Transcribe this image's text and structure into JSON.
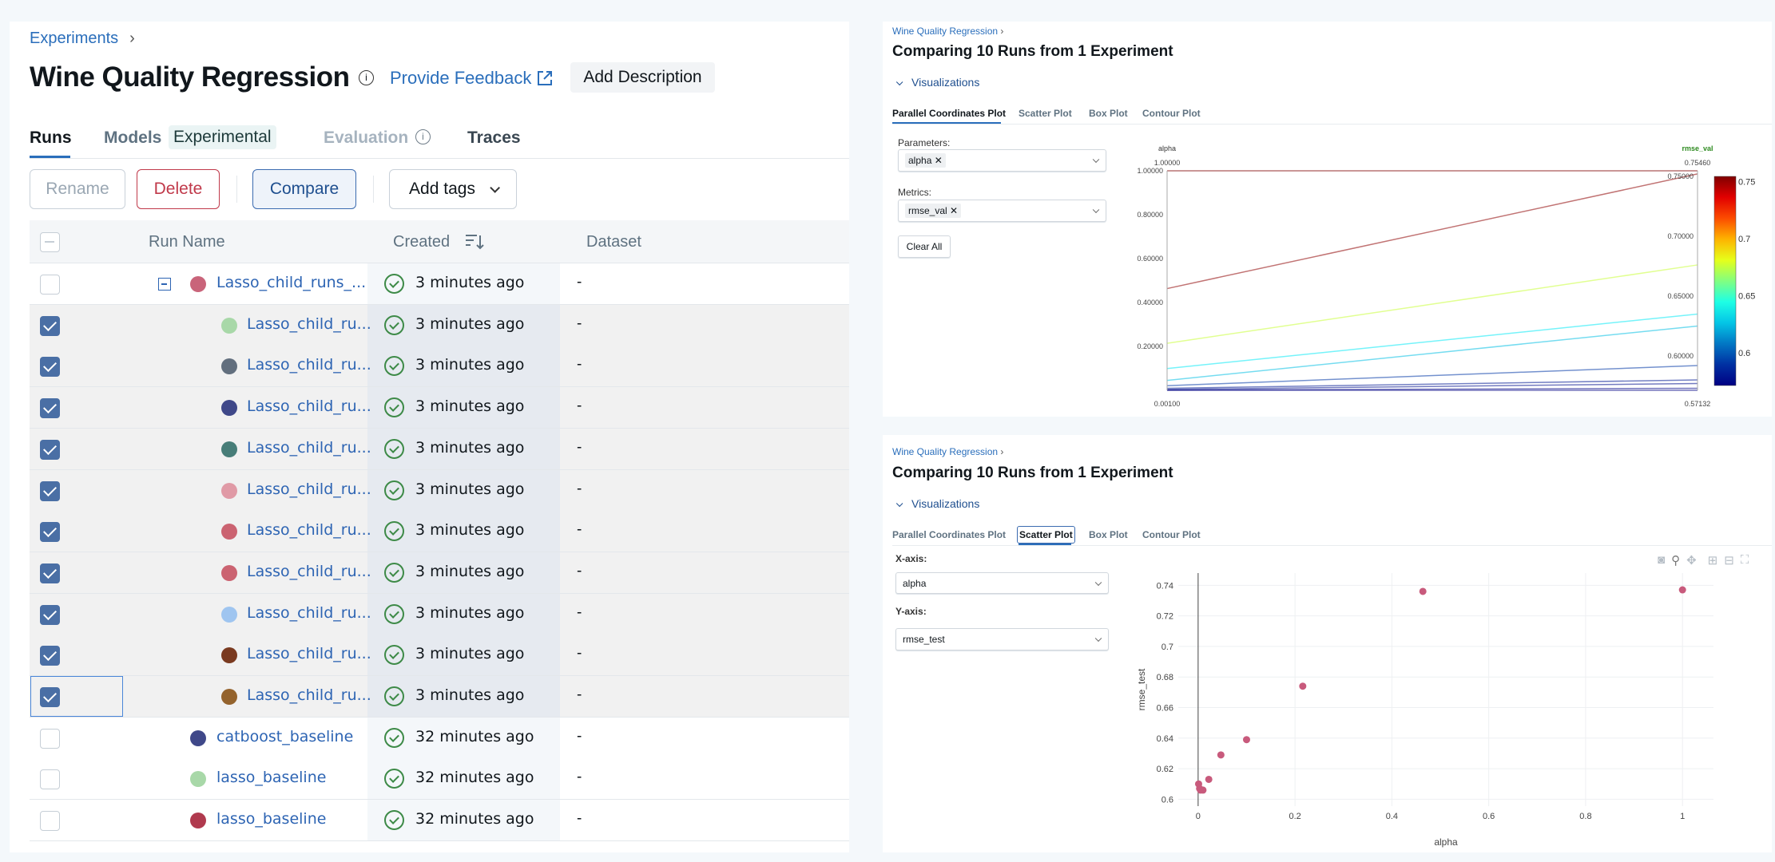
{
  "left": {
    "breadcrumb": "Experiments",
    "title": "Wine Quality Regression",
    "feedback_link": "Provide Feedback",
    "add_description": "Add Description",
    "tabs": [
      {
        "label": "Runs",
        "active": true
      },
      {
        "label": "Models",
        "badge": "Experimental"
      },
      {
        "label": "Evaluation"
      },
      {
        "label": "Traces"
      }
    ],
    "toolbar": {
      "rename": "Rename",
      "delete": "Delete",
      "compare": "Compare",
      "add_tags": "Add tags"
    },
    "columns": {
      "run_name": "Run Name",
      "created": "Created",
      "dataset": "Dataset"
    },
    "rows": [
      {
        "checked": false,
        "level": 0,
        "expandable": true,
        "color": "#c9647a",
        "name": "Lasso_child_runs_...",
        "created": "3 minutes ago",
        "dataset": "-"
      },
      {
        "checked": true,
        "level": 1,
        "color": "#a8d8a8",
        "name": "Lasso_child_ru...",
        "created": "3 minutes ago",
        "dataset": "-"
      },
      {
        "checked": true,
        "level": 1,
        "color": "#626f7e",
        "name": "Lasso_child_ru...",
        "created": "3 minutes ago",
        "dataset": "-"
      },
      {
        "checked": true,
        "level": 1,
        "color": "#3f4889",
        "name": "Lasso_child_ru...",
        "created": "3 minutes ago",
        "dataset": "-"
      },
      {
        "checked": true,
        "level": 1,
        "color": "#477d78",
        "name": "Lasso_child_ru...",
        "created": "3 minutes ago",
        "dataset": "-"
      },
      {
        "checked": true,
        "level": 1,
        "color": "#e09aa6",
        "name": "Lasso_child_ru...",
        "created": "3 minutes ago",
        "dataset": "-"
      },
      {
        "checked": true,
        "level": 1,
        "color": "#cb6371",
        "name": "Lasso_child_ru...",
        "created": "3 minutes ago",
        "dataset": "-"
      },
      {
        "checked": true,
        "level": 1,
        "color": "#cb6371",
        "name": "Lasso_child_ru...",
        "created": "3 minutes ago",
        "dataset": "-"
      },
      {
        "checked": true,
        "level": 1,
        "color": "#9fc5f0",
        "name": "Lasso_child_ru...",
        "created": "3 minutes ago",
        "dataset": "-"
      },
      {
        "checked": true,
        "level": 1,
        "color": "#7a3a20",
        "name": "Lasso_child_ru...",
        "created": "3 minutes ago",
        "dataset": "-"
      },
      {
        "checked": true,
        "level": 1,
        "color": "#94632d",
        "name": "Lasso_child_ru...",
        "created": "3 minutes ago",
        "dataset": "-",
        "focused": true
      },
      {
        "checked": false,
        "level": 0,
        "color": "#3f4889",
        "name": "catboost_baseline",
        "created": "32 minutes ago",
        "dataset": "-"
      },
      {
        "checked": false,
        "level": 0,
        "color": "#a8d8a8",
        "name": "lasso_baseline",
        "created": "32 minutes ago",
        "dataset": "-"
      },
      {
        "checked": false,
        "level": 0,
        "color": "#b03a4e",
        "name": "lasso_baseline",
        "created": "32 minutes ago",
        "dataset": "-"
      }
    ]
  },
  "compare_top": {
    "breadcrumb": "Wine Quality Regression",
    "title": "Comparing 10 Runs from 1 Experiment",
    "section": "Visualizations",
    "tabs": [
      "Parallel Coordinates Plot",
      "Scatter Plot",
      "Box Plot",
      "Contour Plot"
    ],
    "active_tab": "Parallel Coordinates Plot",
    "parameters_label": "Parameters:",
    "parameters_selected": "alpha",
    "metrics_label": "Metrics:",
    "metrics_selected": "rmse_val",
    "clear_all": "Clear All"
  },
  "compare_bottom": {
    "breadcrumb": "Wine Quality Regression",
    "title": "Comparing 10 Runs from 1 Experiment",
    "section": "Visualizations",
    "tabs": [
      "Parallel Coordinates Plot",
      "Scatter Plot",
      "Box Plot",
      "Contour Plot"
    ],
    "active_tab": "Scatter Plot",
    "x_axis_label": "X-axis:",
    "x_axis_value": "alpha",
    "y_axis_label": "Y-axis:",
    "y_axis_value": "rmse_test",
    "toolbar_icons": [
      "camera-icon",
      "zoom-icon",
      "pan-icon",
      "zoom-in-icon",
      "zoom-out-icon",
      "autoscale-icon"
    ]
  },
  "chart_data": [
    {
      "type": "parallel-coordinates",
      "dimensions": [
        {
          "label": "alpha",
          "range": [
            0.001,
            1.0
          ],
          "range_labels": [
            "0.00100",
            "1.00000"
          ],
          "ticks": [
            "0.20000",
            "0.40000",
            "0.60000",
            "0.80000",
            "1.00000"
          ],
          "tick_values": [
            0.2,
            0.4,
            0.6,
            0.8,
            1.0
          ]
        },
        {
          "label": "rmse_val",
          "range": [
            0.57132,
            0.7546
          ],
          "range_labels": [
            "0.57132",
            "0.75460"
          ],
          "ticks": [
            "0.60000",
            "0.65000",
            "0.70000",
            "0.75000"
          ],
          "tick_values": [
            0.6,
            0.65,
            0.7,
            0.75
          ]
        }
      ],
      "lines": [
        [
          1.0,
          0.7546
        ],
        [
          0.464,
          0.752
        ],
        [
          0.215,
          0.676
        ],
        [
          0.1,
          0.635
        ],
        [
          0.046,
          0.625
        ],
        [
          0.022,
          0.592
        ],
        [
          0.01,
          0.58
        ],
        [
          0.005,
          0.577
        ],
        [
          0.002,
          0.573
        ],
        [
          0.001,
          0.5713
        ]
      ],
      "colorscale": "Jet",
      "colorbar": {
        "range": [
          0.57132,
          0.7546
        ],
        "ticks": [
          "0.6",
          "0.65",
          "0.7",
          "0.75"
        ],
        "tick_values": [
          0.6,
          0.65,
          0.7,
          0.75
        ]
      },
      "metric_label_color": "#2e8b20"
    },
    {
      "type": "scatter",
      "xlabel": "alpha",
      "ylabel": "rmse_test",
      "xlim": [
        -0.041,
        1.064
      ],
      "ylim": [
        0.5955,
        0.748
      ],
      "xticks": [
        "0",
        "0.2",
        "0.4",
        "0.6",
        "0.8",
        "1"
      ],
      "xtick_values": [
        0,
        0.2,
        0.4,
        0.6,
        0.8,
        1
      ],
      "yticks": [
        "0.6",
        "0.62",
        "0.64",
        "0.66",
        "0.68",
        "0.7",
        "0.72",
        "0.74"
      ],
      "ytick_values": [
        0.6,
        0.62,
        0.64,
        0.66,
        0.68,
        0.7,
        0.72,
        0.74
      ],
      "grid": true,
      "color": "#c85a7c",
      "points": [
        [
          0.001,
          0.61
        ],
        [
          0.003,
          0.607
        ],
        [
          0.005,
          0.606
        ],
        [
          0.01,
          0.606
        ],
        [
          0.022,
          0.613
        ],
        [
          0.047,
          0.629
        ],
        [
          0.1,
          0.639
        ],
        [
          0.216,
          0.674
        ],
        [
          0.464,
          0.736
        ],
        [
          1.0,
          0.737
        ]
      ]
    }
  ]
}
